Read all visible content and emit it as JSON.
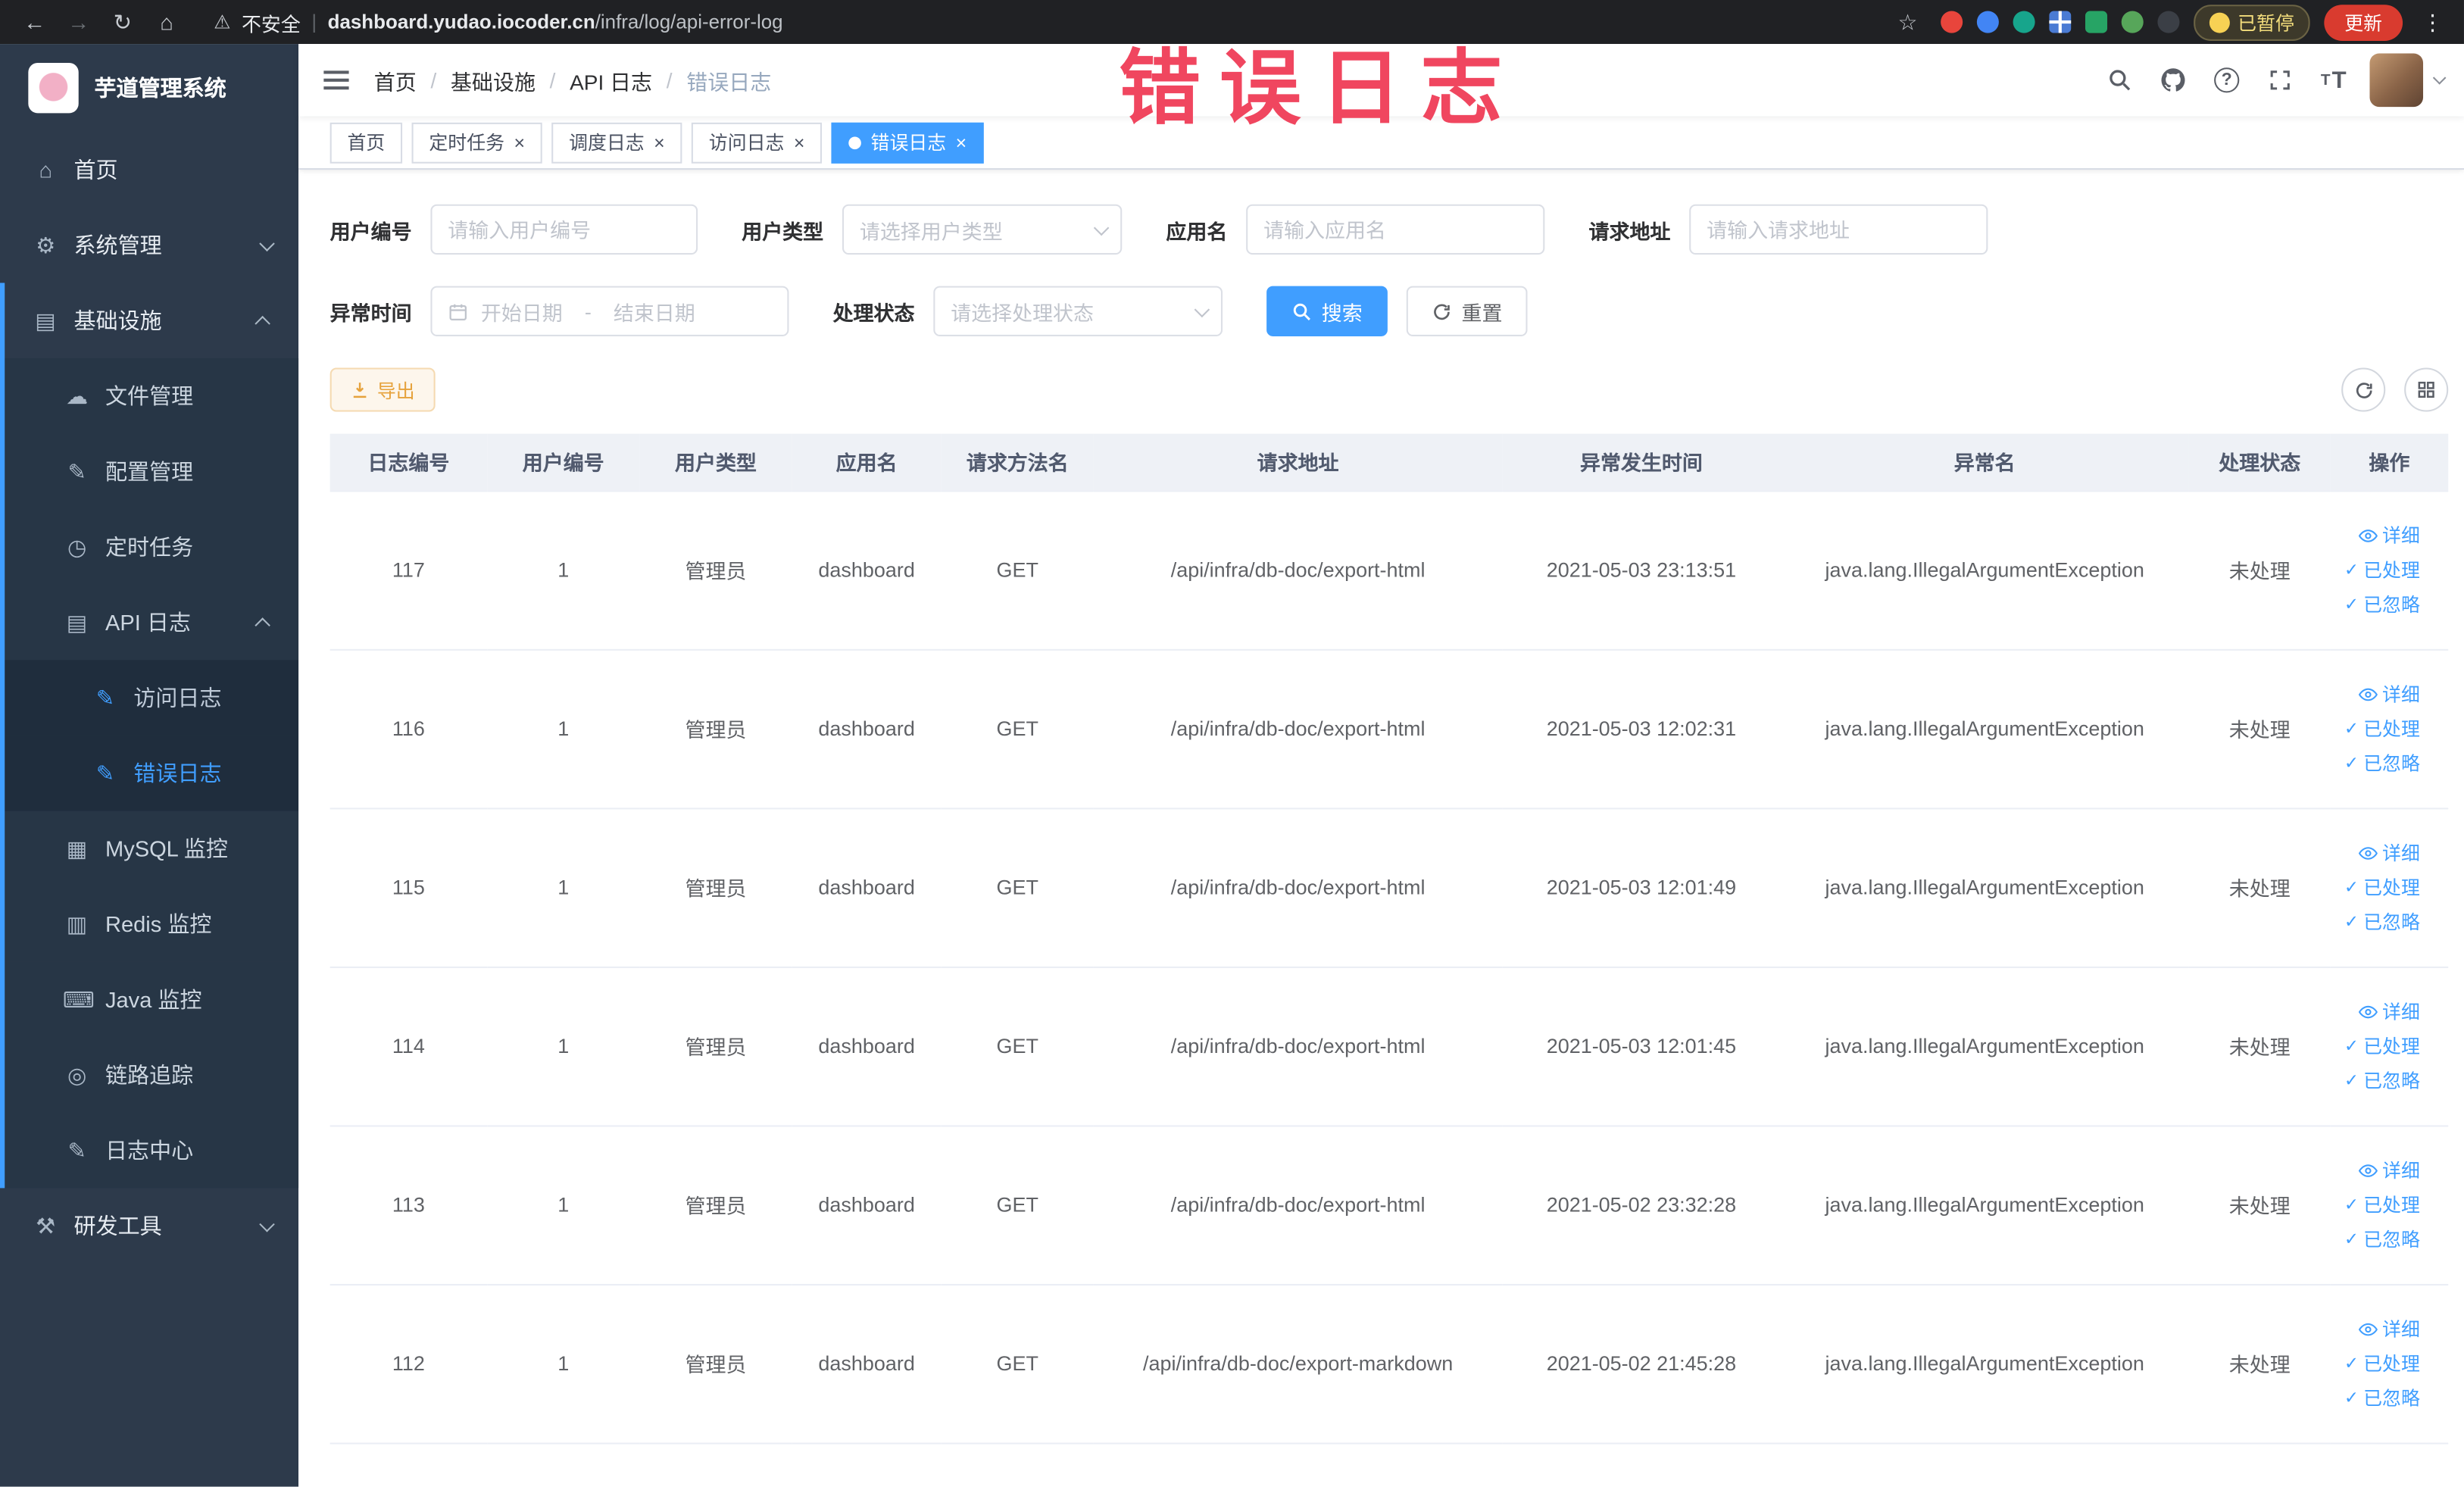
{
  "colors": {
    "accent": "#409eff",
    "annotation": "#f0465f",
    "warning_btn": "#e6a23c",
    "sidebar_bg": "#2d3a4b",
    "active_tab_bg": "#409eff"
  },
  "icons": {
    "back": "←",
    "forward": "→",
    "reload": "↻",
    "home_nav": "⌂",
    "star": "☆",
    "kebab": "⋮",
    "warning": "⚠",
    "pipe": "|",
    "slash": "/",
    "close": "×",
    "check": "✓",
    "question": "?",
    "text_size": "T",
    "home": "⌂",
    "gear": "⚙",
    "infrastructure": "▤",
    "file": "☁",
    "config": "✎",
    "timer": "◷",
    "api_log": "▤",
    "doc_edit": "✎",
    "mysql": "▦",
    "redis": "▥",
    "java": "⌨",
    "trace": "◎",
    "log_center": "✎",
    "tools": "⚒"
  },
  "browser": {
    "warning_label": "不安全",
    "url_host": "dashboard.yudao.iocoder.cn",
    "url_path": "/infra/log/api-error-log",
    "paused_badge": "已暂停",
    "update_button": "更新"
  },
  "annotation": {
    "text": "错误日志"
  },
  "sidebar": {
    "app_title": "芋道管理系统",
    "menu": [
      {
        "label": "首页",
        "icon": "home-icon",
        "depth": 0
      },
      {
        "label": "系统管理",
        "icon": "gear-icon",
        "depth": 0,
        "chevron": "down"
      },
      {
        "label": "基础设施",
        "icon": "infrastructure-icon",
        "depth": 0,
        "chevron": "up",
        "expanded": true
      },
      {
        "label": "文件管理",
        "icon": "file-icon",
        "depth": 1
      },
      {
        "label": "配置管理",
        "icon": "config-icon",
        "depth": 1
      },
      {
        "label": "定时任务",
        "icon": "timer-icon",
        "depth": 1
      },
      {
        "label": "API 日志",
        "icon": "api-log-icon",
        "depth": 1,
        "chevron": "up",
        "expanded": true
      },
      {
        "label": "访问日志",
        "icon": "access-log-icon",
        "depth": 2
      },
      {
        "label": "错误日志",
        "icon": "error-log-icon",
        "depth": 2,
        "active": true
      },
      {
        "label": "MySQL 监控",
        "icon": "mysql-icon",
        "depth": 1
      },
      {
        "label": "Redis 监控",
        "icon": "redis-icon",
        "depth": 1
      },
      {
        "label": "Java 监控",
        "icon": "java-icon",
        "depth": 1
      },
      {
        "label": "链路追踪",
        "icon": "trace-icon",
        "depth": 1
      },
      {
        "label": "日志中心",
        "icon": "log-center-icon",
        "depth": 1
      },
      {
        "label": "研发工具",
        "icon": "tools-icon",
        "depth": 0,
        "chevron": "down"
      }
    ]
  },
  "breadcrumb": [
    "首页",
    "基础设施",
    "API 日志",
    "错误日志"
  ],
  "tabs": [
    {
      "label": "首页",
      "closable": false,
      "active": false
    },
    {
      "label": "定时任务",
      "closable": true,
      "active": false
    },
    {
      "label": "调度日志",
      "closable": true,
      "active": false
    },
    {
      "label": "访问日志",
      "closable": true,
      "active": false
    },
    {
      "label": "错误日志",
      "closable": true,
      "active": true
    }
  ],
  "filters": {
    "user_id": {
      "label": "用户编号",
      "placeholder": "请输入用户编号"
    },
    "user_type": {
      "label": "用户类型",
      "placeholder": "请选择用户类型"
    },
    "app_name": {
      "label": "应用名",
      "placeholder": "请输入应用名"
    },
    "request_url": {
      "label": "请求地址",
      "placeholder": "请输入请求地址"
    },
    "exception_time": {
      "label": "异常时间",
      "start_placeholder": "开始日期",
      "separator": "-",
      "end_placeholder": "结束日期"
    },
    "process_status": {
      "label": "处理状态",
      "placeholder": "请选择处理状态"
    },
    "search_button": "搜索",
    "reset_button": "重置"
  },
  "toolbar": {
    "export_button": "导出"
  },
  "table": {
    "columns": [
      "日志编号",
      "用户编号",
      "用户类型",
      "应用名",
      "请求方法名",
      "请求地址",
      "异常发生时间",
      "异常名",
      "处理状态",
      "操作"
    ],
    "row_actions": [
      "详细",
      "已处理",
      "已忽略"
    ],
    "rows": [
      {
        "id": "117",
        "user_id": "1",
        "user_type": "管理员",
        "app": "dashboard",
        "method": "GET",
        "url": "/api/infra/db-doc/export-html",
        "time": "2021-05-03 23:13:51",
        "exception": "java.lang.IllegalArgumentException",
        "status": "未处理"
      },
      {
        "id": "116",
        "user_id": "1",
        "user_type": "管理员",
        "app": "dashboard",
        "method": "GET",
        "url": "/api/infra/db-doc/export-html",
        "time": "2021-05-03 12:02:31",
        "exception": "java.lang.IllegalArgumentException",
        "status": "未处理"
      },
      {
        "id": "115",
        "user_id": "1",
        "user_type": "管理员",
        "app": "dashboard",
        "method": "GET",
        "url": "/api/infra/db-doc/export-html",
        "time": "2021-05-03 12:01:49",
        "exception": "java.lang.IllegalArgumentException",
        "status": "未处理"
      },
      {
        "id": "114",
        "user_id": "1",
        "user_type": "管理员",
        "app": "dashboard",
        "method": "GET",
        "url": "/api/infra/db-doc/export-html",
        "time": "2021-05-03 12:01:45",
        "exception": "java.lang.IllegalArgumentException",
        "status": "未处理"
      },
      {
        "id": "113",
        "user_id": "1",
        "user_type": "管理员",
        "app": "dashboard",
        "method": "GET",
        "url": "/api/infra/db-doc/export-html",
        "time": "2021-05-02 23:32:28",
        "exception": "java.lang.IllegalArgumentException",
        "status": "未处理"
      },
      {
        "id": "112",
        "user_id": "1",
        "user_type": "管理员",
        "app": "dashboard",
        "method": "GET",
        "url": "/api/infra/db-doc/export-markdown",
        "time": "2021-05-02 21:45:28",
        "exception": "java.lang.IllegalArgumentException",
        "status": "未处理"
      }
    ]
  }
}
